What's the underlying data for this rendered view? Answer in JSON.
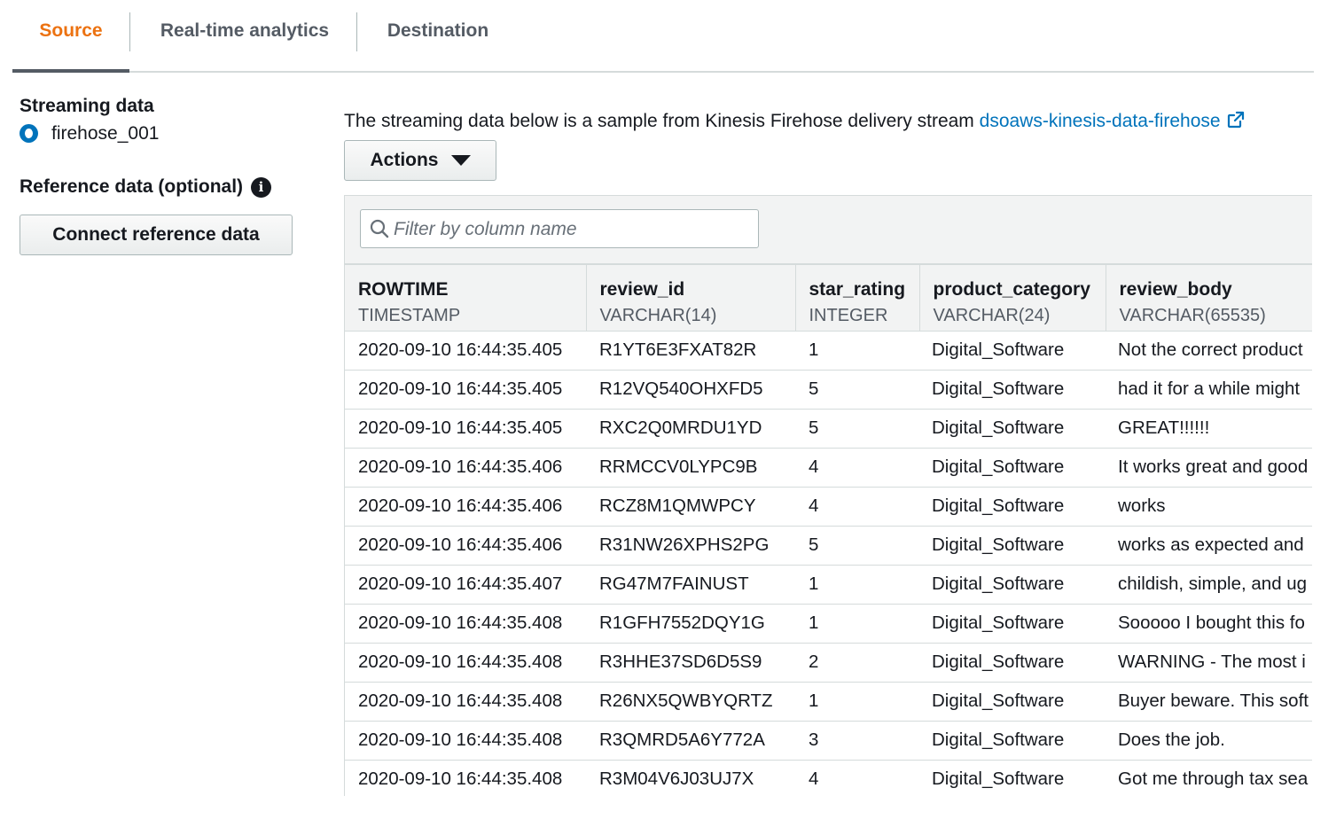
{
  "tabs": [
    {
      "label": "Source",
      "active": true
    },
    {
      "label": "Real-time analytics",
      "active": false
    },
    {
      "label": "Destination",
      "active": false
    }
  ],
  "left": {
    "streaming_heading": "Streaming data",
    "stream_name": "firehose_001",
    "reference_heading": "Reference data (optional)",
    "connect_button": "Connect reference data"
  },
  "main": {
    "description": "The streaming data below is a sample from Kinesis Firehose delivery stream",
    "stream_link": "dsoaws-kinesis-data-firehose",
    "actions_button": "Actions",
    "filter_placeholder": "Filter by column name"
  },
  "colors": {
    "accent": "#ec7211",
    "link": "#0073bb",
    "header_bg": "#f2f3f3"
  },
  "columns": [
    {
      "name": "ROWTIME",
      "type": "TIMESTAMP"
    },
    {
      "name": "review_id",
      "type": "VARCHAR(14)"
    },
    {
      "name": "star_rating",
      "type": "INTEGER"
    },
    {
      "name": "product_category",
      "type": "VARCHAR(24)"
    },
    {
      "name": "review_body",
      "type": "VARCHAR(65535)"
    }
  ],
  "rows": [
    [
      "2020-09-10 16:44:35.405",
      "R1YT6E3FXAT82R",
      "1",
      "Digital_Software",
      "Not the correct product"
    ],
    [
      "2020-09-10 16:44:35.405",
      "R12VQ540OHXFD5",
      "5",
      "Digital_Software",
      "had it for a while might"
    ],
    [
      "2020-09-10 16:44:35.405",
      "RXC2Q0MRDU1YD",
      "5",
      "Digital_Software",
      "GREAT!!!!!!"
    ],
    [
      "2020-09-10 16:44:35.406",
      "RRMCCV0LYPC9B",
      "4",
      "Digital_Software",
      "It works great and good"
    ],
    [
      "2020-09-10 16:44:35.406",
      "RCZ8M1QMWPCY",
      "4",
      "Digital_Software",
      "works"
    ],
    [
      "2020-09-10 16:44:35.406",
      "R31NW26XPHS2PG",
      "5",
      "Digital_Software",
      "works as expected and"
    ],
    [
      "2020-09-10 16:44:35.407",
      "RG47M7FAINUST",
      "1",
      "Digital_Software",
      "childish, simple, and ug"
    ],
    [
      "2020-09-10 16:44:35.408",
      "R1GFH7552DQY1G",
      "1",
      "Digital_Software",
      "Sooooo I bought this fo"
    ],
    [
      "2020-09-10 16:44:35.408",
      "R3HHE37SD6D5S9",
      "2",
      "Digital_Software",
      "WARNING - The most i"
    ],
    [
      "2020-09-10 16:44:35.408",
      "R26NX5QWBYQRTZ",
      "1",
      "Digital_Software",
      "Buyer beware. This soft"
    ],
    [
      "2020-09-10 16:44:35.408",
      "R3QMRD5A6Y772A",
      "3",
      "Digital_Software",
      "Does the job."
    ],
    [
      "2020-09-10 16:44:35.408",
      "R3M04V6J03UJ7X",
      "4",
      "Digital_Software",
      "Got me through tax sea"
    ]
  ]
}
